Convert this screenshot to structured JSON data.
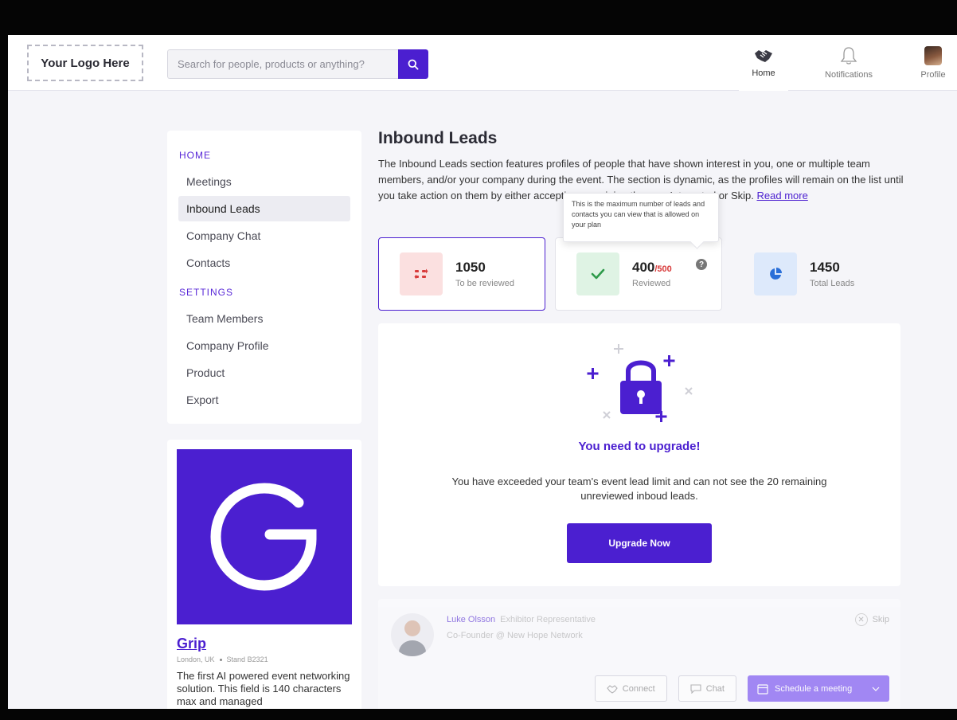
{
  "header": {
    "logo_text": "Your Logo Here",
    "search_placeholder": "Search for people, products or anything?",
    "nav": [
      {
        "label": "Home",
        "icon": "handshake-icon"
      },
      {
        "label": "Notifications",
        "icon": "bell-icon"
      },
      {
        "label": "Profile",
        "icon": "avatar"
      }
    ]
  },
  "sidebar": {
    "home_title": "HOME",
    "home_items": [
      "Meetings",
      "Inbound Leads",
      "Company Chat",
      "Contacts"
    ],
    "active_item": "Inbound Leads",
    "settings_title": "SETTINGS",
    "settings_items": [
      "Team Members",
      "Company Profile",
      "Product",
      "Export"
    ]
  },
  "company": {
    "name": "Grip",
    "location": "London, UK",
    "stand": "Stand B2321",
    "description": "The first AI powered event networking solution. This field is 140 characters max and managed",
    "brand_color": "#4b1fd0"
  },
  "main": {
    "title": "Inbound Leads",
    "intro_before": "The Inbound Leads section features profiles of people that have shown interest in you, one or multiple team members, and/or your company during the event. The section is dynamic, as the profiles will remain on the list until you take action on them by either accepting or swiping them as Interested or Skip.",
    "read_more": "Read more",
    "tooltip": "This is the maximum number of leads and contacts you can view that is allowed on your plan",
    "stats": [
      {
        "value": "1050",
        "label": "To be reviewed",
        "icon": "shuffle-icon",
        "color": "#d83a3a"
      },
      {
        "value": "400",
        "limit": "/500",
        "label": "Reviewed",
        "icon": "check-icon",
        "color": "#2e9a4a"
      },
      {
        "value": "1450",
        "label": "Total Leads",
        "icon": "pie-chart-icon",
        "color": "#2a6fd8"
      }
    ],
    "upgrade": {
      "title": "You need to upgrade!",
      "text": "You have exceeded your team's event lead limit and can not see the 20 remaining unreviewed inboud leads.",
      "button": "Upgrade Now"
    },
    "lead": {
      "name": "Luke Olsson",
      "role": "Exhibitor Representative",
      "subtitle": "Co-Founder @ New Hope Network",
      "skip": "Skip",
      "connect": "Connect",
      "chat": "Chat",
      "schedule": "Schedule a meeting"
    }
  }
}
